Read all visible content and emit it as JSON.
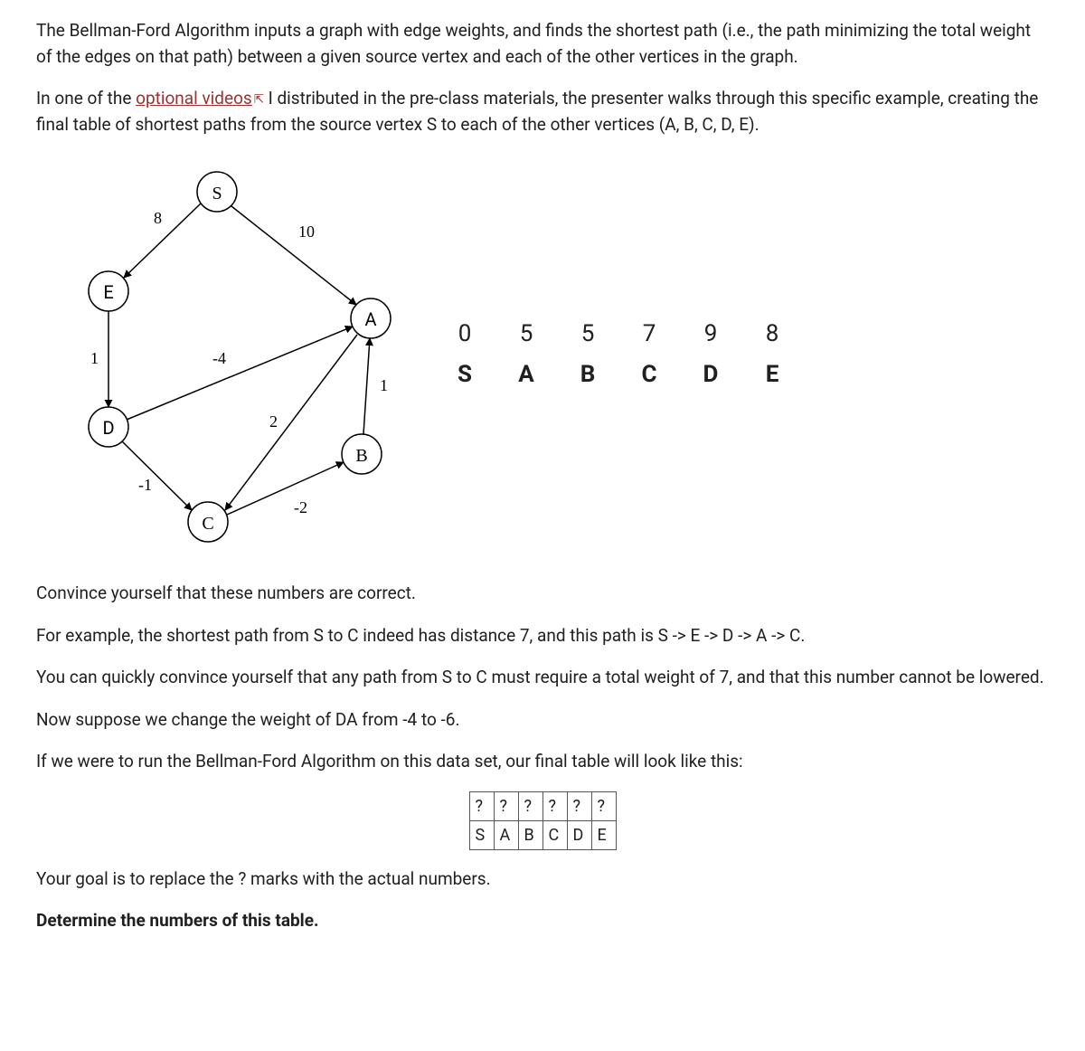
{
  "paragraphs": {
    "p1": "The Bellman-Ford Algorithm inputs a graph with edge weights, and finds the shortest path (i.e., the path minimizing the total weight of the edges on that path) between a given source vertex and each of the other vertices in the graph.",
    "p2a": "In one of the ",
    "p2_link": "optional videos",
    "p2b": " I distributed in the pre-class materials, the presenter walks through this specific example, creating the final table of shortest paths from the source vertex S to each of the other vertices (A, B, C, D, E).",
    "p3": "Convince yourself that these numbers are correct.",
    "p4": "For example, the shortest path from S to C indeed has distance 7, and this path is S -> E -> D -> A -> C.",
    "p5": "You can quickly convince yourself that any path from S to C must require a total weight of 7, and that this number cannot be lowered.",
    "p6": "Now suppose we change the weight of DA from -4 to -6.",
    "p7": "If we were to run the Bellman-Ford Algorithm on this data set, our final table will look like this:",
    "p8": "Your goal is to replace the ? marks with the actual numbers.",
    "p9": "Determine the numbers of this table."
  },
  "graph": {
    "nodes": {
      "S": "S",
      "E": "E",
      "A": "A",
      "D": "D",
      "B": "B",
      "C": "C"
    },
    "edge_weights": {
      "SE": "8",
      "SA": "10",
      "ED": "1",
      "DA": "-4",
      "AC": "2",
      "BA": "1",
      "DC": "-1",
      "CB": "-2"
    }
  },
  "result_table": {
    "values": [
      "0",
      "5",
      "5",
      "7",
      "9",
      "8"
    ],
    "labels": [
      "S",
      "A",
      "B",
      "C",
      "D",
      "E"
    ]
  },
  "mini_table": {
    "row1": [
      "?",
      "?",
      "?",
      "?",
      "?",
      "?"
    ],
    "row2": [
      "S",
      "A",
      "B",
      "C",
      "D",
      "E"
    ]
  }
}
